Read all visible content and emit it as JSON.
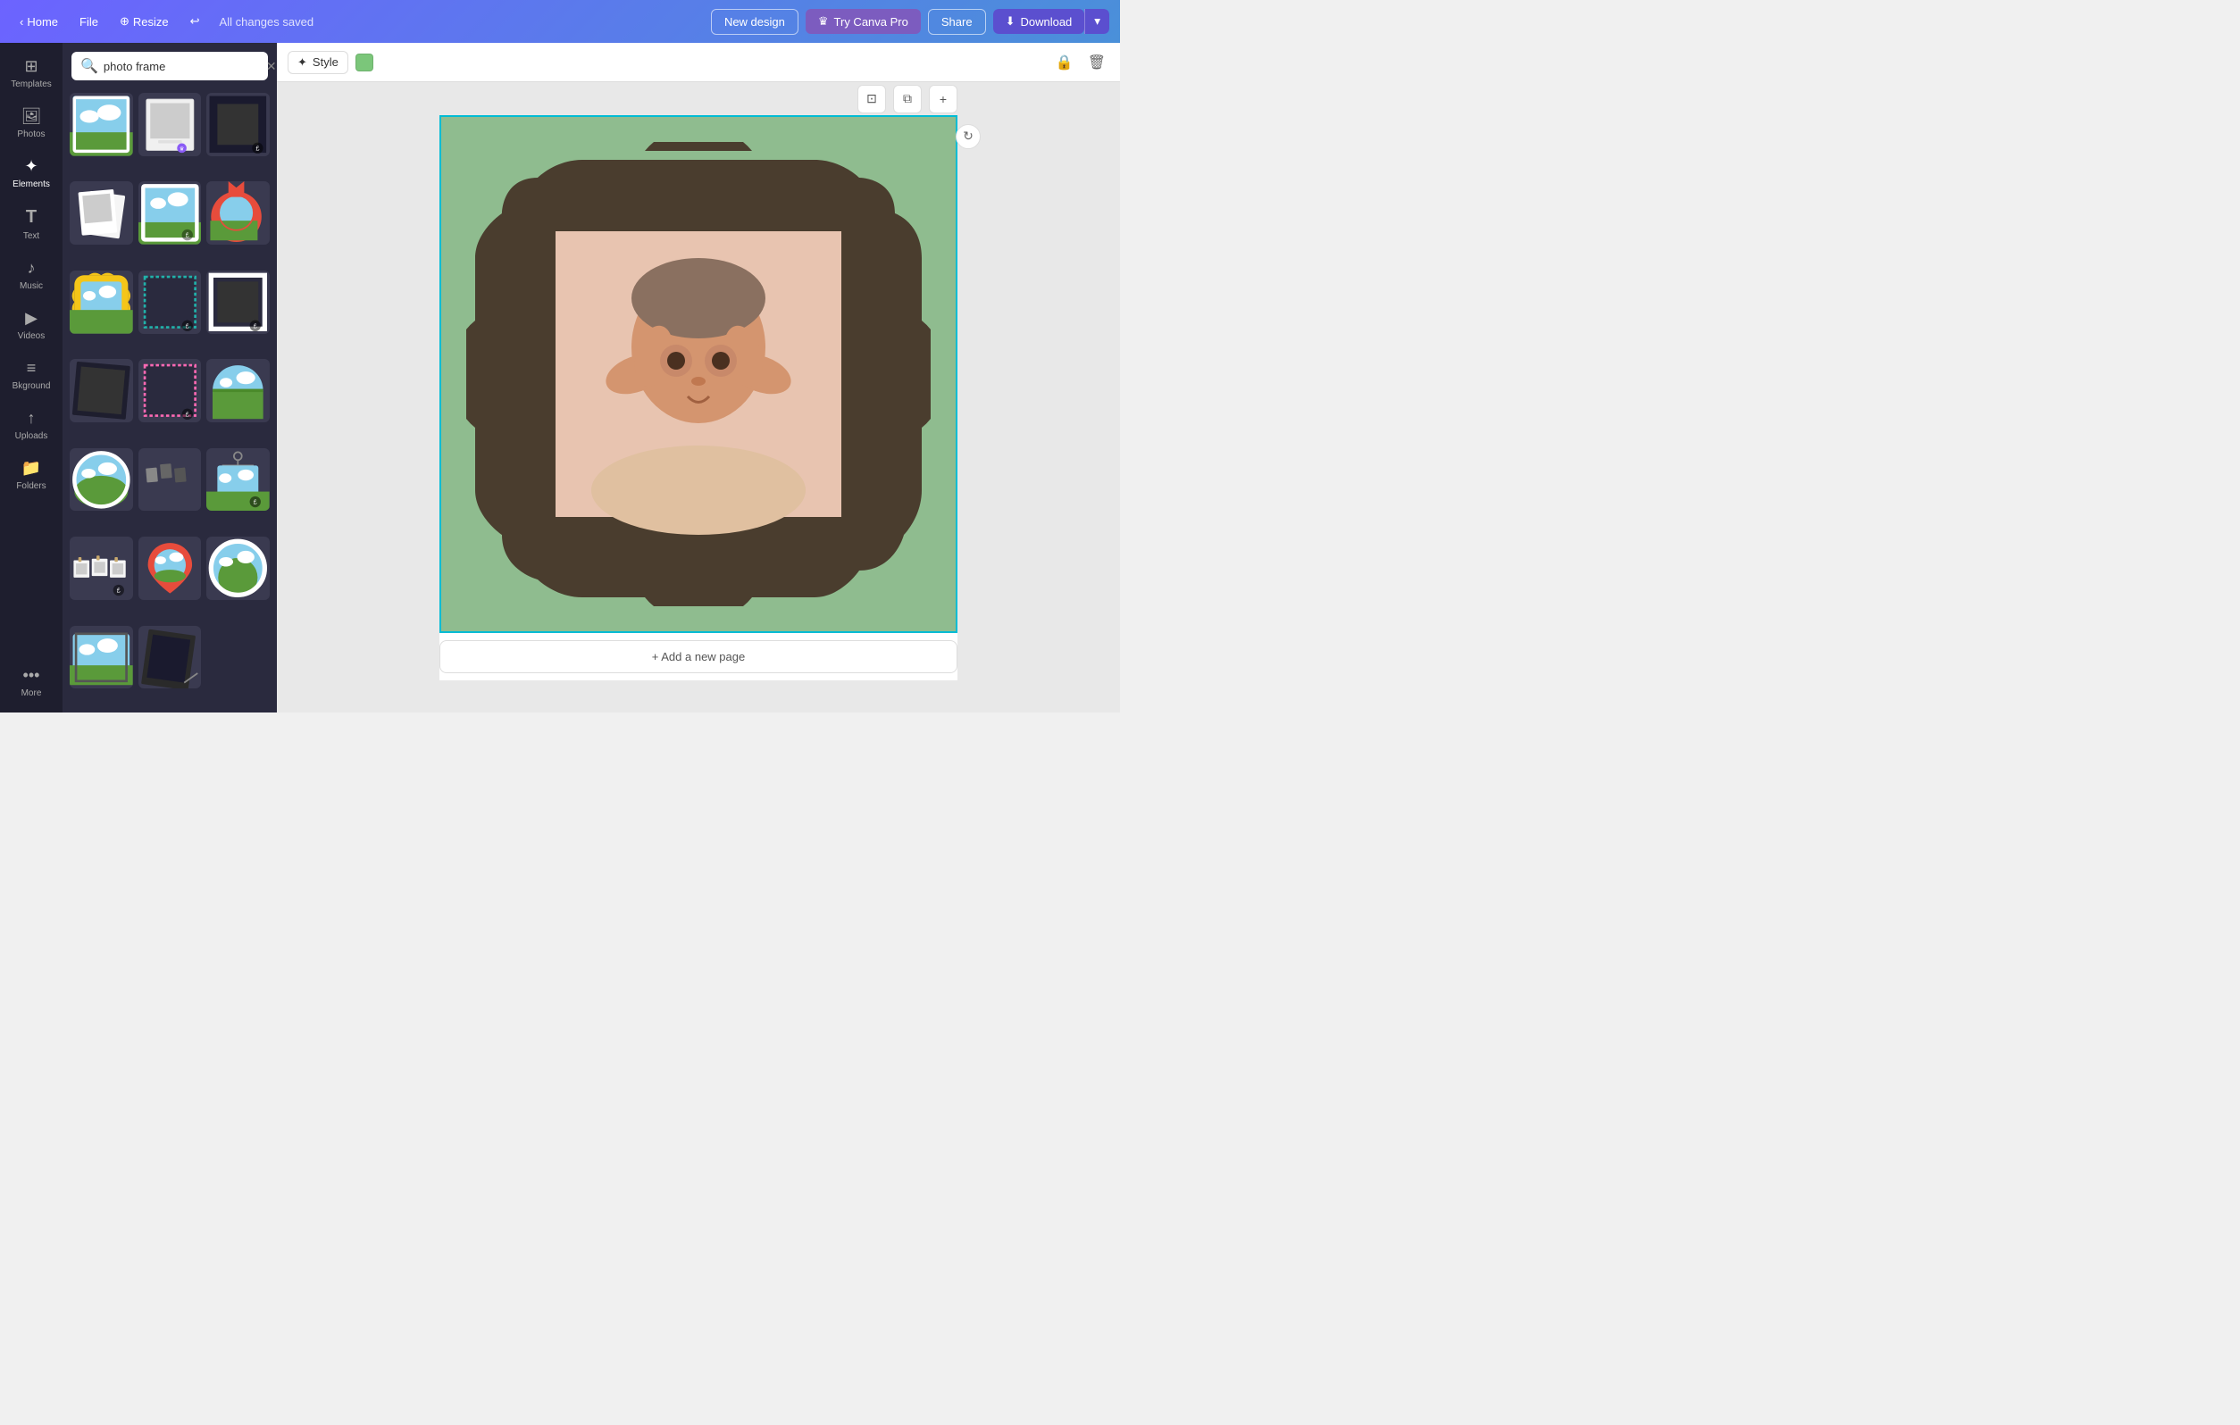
{
  "topbar": {
    "home_label": "Home",
    "file_label": "File",
    "resize_label": "Resize",
    "saved_text": "All changes saved",
    "new_design_label": "New design",
    "try_pro_label": "Try Canva Pro",
    "share_label": "Share",
    "download_label": "Download",
    "undo_icon": "↩"
  },
  "sidebar": {
    "items": [
      {
        "id": "templates",
        "label": "Templates",
        "icon": "⊞"
      },
      {
        "id": "photos",
        "label": "Photos",
        "icon": "🖼"
      },
      {
        "id": "elements",
        "label": "Elements",
        "icon": "✦"
      },
      {
        "id": "text",
        "label": "Text",
        "icon": "T"
      },
      {
        "id": "music",
        "label": "Music",
        "icon": "♪"
      },
      {
        "id": "videos",
        "label": "Videos",
        "icon": "▶"
      },
      {
        "id": "background",
        "label": "Bkground",
        "icon": "≡"
      },
      {
        "id": "uploads",
        "label": "Uploads",
        "icon": "↑"
      },
      {
        "id": "folders",
        "label": "Folders",
        "icon": "📁"
      },
      {
        "id": "more",
        "label": "More",
        "icon": "•••"
      }
    ]
  },
  "search": {
    "placeholder": "photo frame",
    "value": "photo frame"
  },
  "toolbar": {
    "style_label": "Style",
    "color": "#7bc67a",
    "add_page_label": "+ Add a new page"
  },
  "frames": [
    {
      "id": 1,
      "type": "landscape-cloud",
      "badge": ""
    },
    {
      "id": 2,
      "type": "polaroid",
      "badge": ""
    },
    {
      "id": 3,
      "type": "black-square",
      "badge": "£"
    },
    {
      "id": 4,
      "type": "double-polaroid",
      "badge": ""
    },
    {
      "id": 5,
      "type": "green-landscape",
      "badge": "£"
    },
    {
      "id": 6,
      "type": "red-circle",
      "badge": ""
    },
    {
      "id": 7,
      "type": "gold-ornate",
      "badge": ""
    },
    {
      "id": 8,
      "type": "dotted-teal",
      "badge": "£"
    },
    {
      "id": 9,
      "type": "white-square",
      "badge": "£"
    },
    {
      "id": 10,
      "type": "dark-square",
      "badge": ""
    },
    {
      "id": 11,
      "type": "pink-dotted",
      "badge": "£"
    },
    {
      "id": 12,
      "type": "half-circle",
      "badge": ""
    },
    {
      "id": 13,
      "type": "oval-cloud",
      "badge": ""
    },
    {
      "id": 14,
      "type": "film-strip",
      "badge": ""
    },
    {
      "id": 15,
      "type": "hanger-frame",
      "badge": "£"
    },
    {
      "id": 16,
      "type": "photo-clips",
      "badge": "£"
    },
    {
      "id": 17,
      "type": "map-pin-circle",
      "badge": ""
    },
    {
      "id": 18,
      "type": "white-circle",
      "badge": ""
    },
    {
      "id": 19,
      "type": "cloud-small",
      "badge": ""
    },
    {
      "id": 20,
      "type": "dark-tilt",
      "badge": ""
    }
  ]
}
